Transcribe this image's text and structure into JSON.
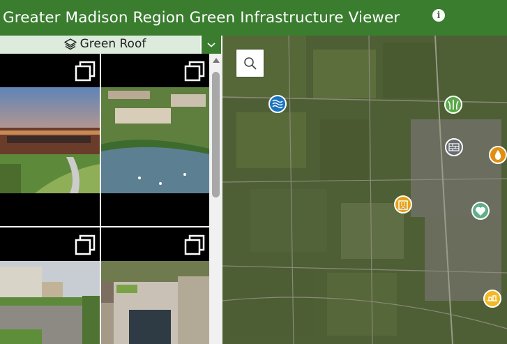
{
  "header": {
    "title": "Greater Madison Region Green Infrastructure Viewer",
    "info_icon": "info-icon",
    "color": "#3a7d2f"
  },
  "filter": {
    "selected": "Green Roof",
    "icon": "layers-icon",
    "dropdown_icon": "chevron-down-icon"
  },
  "gallery": {
    "items": [
      {
        "name": "campus-building-sunset-photo",
        "icon": "open-gallery-icon"
      },
      {
        "name": "campus-aerial-lake-photo",
        "icon": "open-gallery-icon"
      },
      {
        "name": "rooftop-terrace-photo",
        "icon": "open-gallery-icon"
      },
      {
        "name": "brick-building-green-roof-photo",
        "icon": "open-gallery-icon"
      }
    ]
  },
  "map": {
    "search_icon": "search-icon",
    "markers": [
      {
        "name": "water-marker",
        "color": "#1a73c0"
      },
      {
        "name": "grass-marker",
        "color": "#5aa847"
      },
      {
        "name": "permeable-pavement-marker",
        "color": "#666b70"
      },
      {
        "name": "rain-drop-marker",
        "color": "#e08f12"
      },
      {
        "name": "building-marker",
        "color": "#e5a219"
      },
      {
        "name": "heart-leaf-marker",
        "color": "#5fb08a"
      },
      {
        "name": "hands-marker",
        "color": "#f2b824"
      }
    ]
  }
}
